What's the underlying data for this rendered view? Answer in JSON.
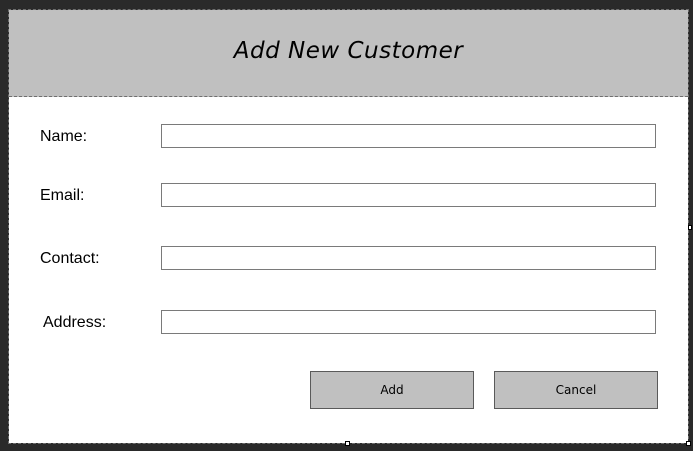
{
  "form": {
    "title": "Add New Customer",
    "fields": [
      {
        "label": "Name:",
        "value": "",
        "placeholder": ""
      },
      {
        "label": "Email:",
        "value": "",
        "placeholder": ""
      },
      {
        "label": "Contact:",
        "value": "",
        "placeholder": ""
      },
      {
        "label": "Address:",
        "value": "",
        "placeholder": ""
      }
    ],
    "buttons": {
      "add_label": "Add",
      "cancel_label": "Cancel"
    }
  },
  "colors": {
    "header_bg": "#c0c0c0",
    "button_bg": "#c0c0c0",
    "designer_bg": "#2a2a2a"
  }
}
